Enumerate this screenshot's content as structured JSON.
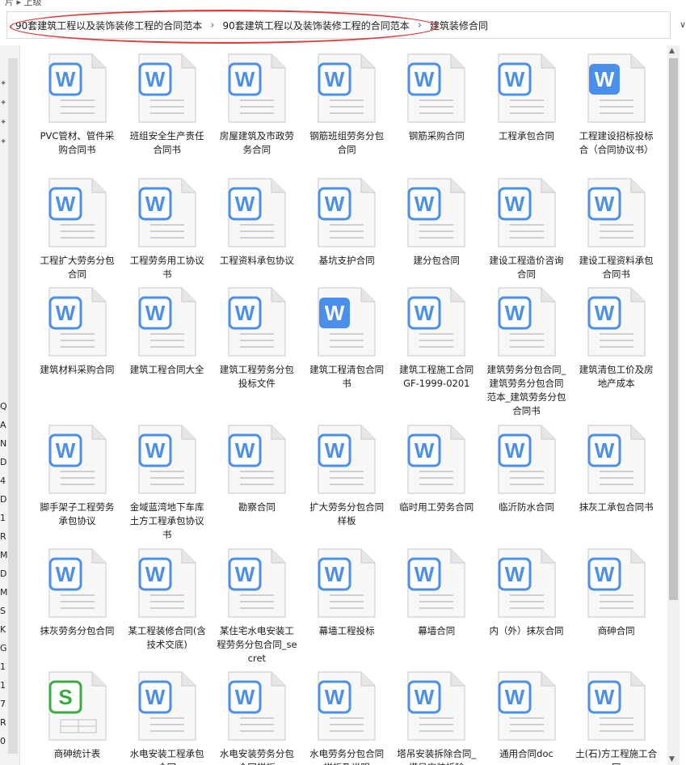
{
  "window": {
    "top_fragment": "片 ▸ 上级"
  },
  "address_bar": {
    "crumbs": [
      "90套建筑工程以及装饰装修工程的合同范本",
      "90套建筑工程以及装饰装修工程的合同范本",
      "建筑装修合同"
    ],
    "separator": "›",
    "dropdown_icon": "∨"
  },
  "left_pane": {
    "pins": [
      "✦",
      "✦",
      "✦",
      "✦"
    ],
    "clipped_labels": [
      "Q",
      "A",
      "N",
      "D",
      "4",
      "D",
      "1",
      "R",
      "M",
      "D",
      "M",
      "S",
      "K",
      "G",
      "1",
      "1",
      "7",
      "R",
      "0"
    ]
  },
  "scrollbar": {
    "up_arrow": "▲",
    "down_arrow": "▼"
  },
  "icons": {
    "word": {
      "color": "#4a8fea",
      "letter": "W"
    },
    "spreadsheet": {
      "color": "#3daa42",
      "letter": "S"
    }
  },
  "files": [
    {
      "name": "PVC管材、管件采购合同书",
      "type": "word"
    },
    {
      "name": "班组安全生产责任合同书",
      "type": "word"
    },
    {
      "name": "房屋建筑及市政劳务合同",
      "type": "word"
    },
    {
      "name": "钢筋班组劳务分包合同",
      "type": "word"
    },
    {
      "name": "钢筋采购合同",
      "type": "word"
    },
    {
      "name": "工程承包合同",
      "type": "word"
    },
    {
      "name": "工程建设招标投标合（合同协议书）",
      "type": "word",
      "style": "filled"
    },
    {
      "name": "工程扩大劳务分包合同",
      "type": "word"
    },
    {
      "name": "工程劳务用工协议书",
      "type": "word"
    },
    {
      "name": "工程资料承包协议",
      "type": "word"
    },
    {
      "name": "基坑支护合同",
      "type": "word"
    },
    {
      "name": "建分包合同",
      "type": "word"
    },
    {
      "name": "建设工程造价咨询合同",
      "type": "word"
    },
    {
      "name": "建设工程资料承包合同书",
      "type": "word"
    },
    {
      "name": "建筑材料采购合同",
      "type": "word"
    },
    {
      "name": "建筑工程合同大全",
      "type": "word"
    },
    {
      "name": "建筑工程劳务分包投标文件",
      "type": "word"
    },
    {
      "name": "建筑工程清包合同书",
      "type": "word",
      "style": "filled"
    },
    {
      "name": "建筑工程施工合同 GF-1999-0201",
      "type": "word"
    },
    {
      "name": "建筑劳务分包合同_建筑劳务分包合同范本_建筑劳务分包合同书",
      "type": "word"
    },
    {
      "name": "建筑清包工价及房地产成本",
      "type": "word"
    },
    {
      "name": "脚手架子工程劳务承包协议",
      "type": "word"
    },
    {
      "name": "金域蓝湾地下车库土方工程承包协议书",
      "type": "word"
    },
    {
      "name": "勘察合同",
      "type": "word"
    },
    {
      "name": "扩大劳务分包合同样板",
      "type": "word"
    },
    {
      "name": "临时用工劳务合同",
      "type": "word"
    },
    {
      "name": "临沂防水合同",
      "type": "word"
    },
    {
      "name": "抹灰工承包合同书",
      "type": "word"
    },
    {
      "name": "抹灰劳务分包合同",
      "type": "word"
    },
    {
      "name": "某工程装修合同(含技术交底)",
      "type": "word"
    },
    {
      "name": "某住宅水电安装工程劳务分包合同_secret",
      "type": "word"
    },
    {
      "name": "幕墙工程投标",
      "type": "word"
    },
    {
      "name": "幕墙合同",
      "type": "word"
    },
    {
      "name": "内（外）抹灰合同",
      "type": "word"
    },
    {
      "name": "商砷合同",
      "type": "word"
    },
    {
      "name": "商砷统计表",
      "type": "spreadsheet"
    },
    {
      "name": "水电安装工程承包合同",
      "type": "word"
    },
    {
      "name": "水电安装劳务分包合同样板",
      "type": "word"
    },
    {
      "name": "水电劳务分包合同样板及说明",
      "type": "word"
    },
    {
      "name": "塔吊安装拆除合同_塔吊安装拆除",
      "type": "word"
    },
    {
      "name": "通用合同doc",
      "type": "word"
    },
    {
      "name": "土(石)方工程施工合同",
      "type": "word"
    }
  ]
}
